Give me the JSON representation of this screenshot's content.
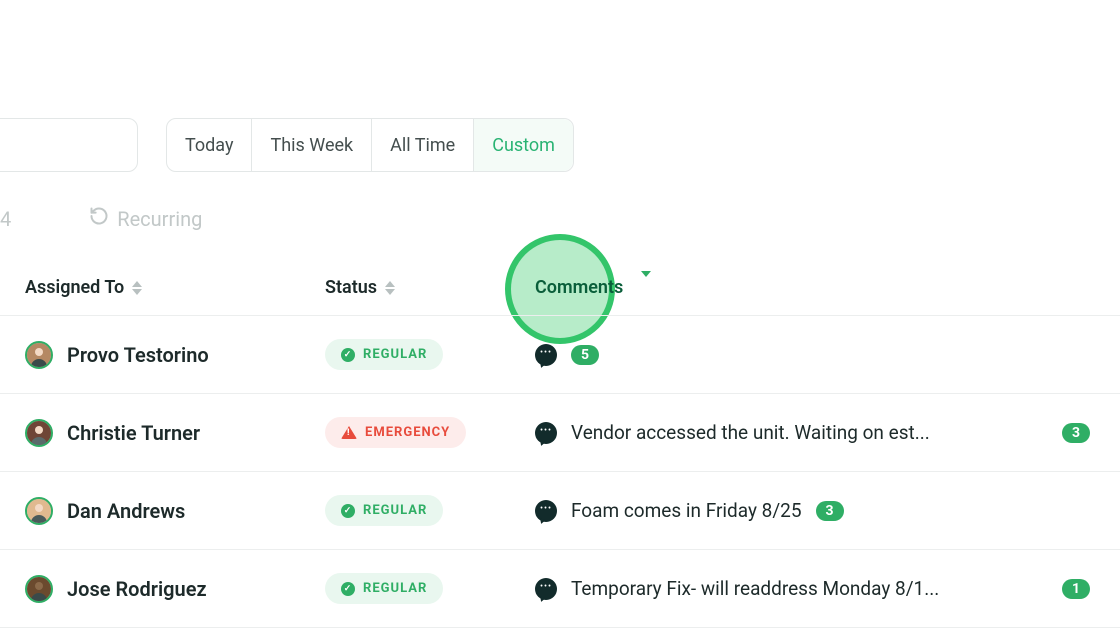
{
  "tabs": {
    "today": "Today",
    "this_week": "This Week",
    "all_time": "All Time",
    "custom": "Custom"
  },
  "secondary": {
    "leading_digit": "4",
    "recurring_label": "Recurring"
  },
  "columns": {
    "assigned": "Assigned To",
    "status": "Status",
    "comments": "Comments"
  },
  "status_labels": {
    "regular": "REGULAR",
    "emergency": "EMERGENCY"
  },
  "rows": [
    {
      "name": "Provo Testorino",
      "status": "regular",
      "comment_text": "",
      "count": "5",
      "avatar_bg": "#b58863"
    },
    {
      "name": "Christie Turner",
      "status": "emergency",
      "comment_text": "Vendor accessed the unit. Waiting on est...",
      "count": "3",
      "avatar_bg": "#6f4536"
    },
    {
      "name": "Dan Andrews",
      "status": "regular",
      "comment_text": "Foam comes in Friday 8/25",
      "count": "3",
      "avatar_bg": "#e0b98f"
    },
    {
      "name": "Jose Rodriguez",
      "status": "regular",
      "comment_text": "Temporary Fix- will readdress Monday 8/1...",
      "count": "1",
      "avatar_bg": "#6b4a2e"
    }
  ]
}
